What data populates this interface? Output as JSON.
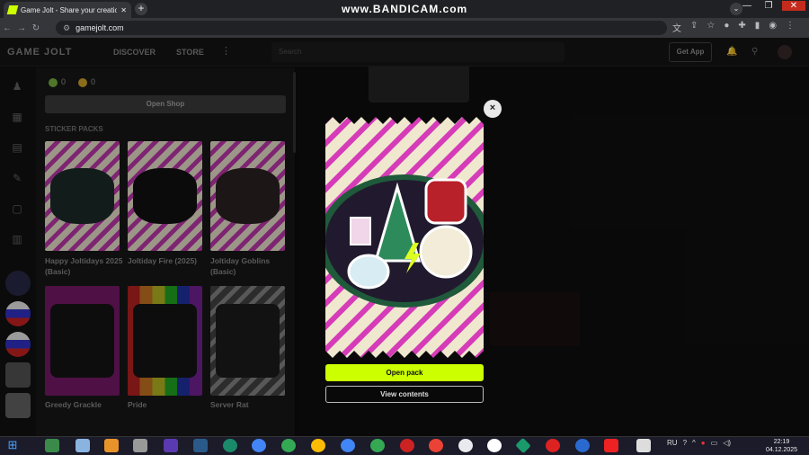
{
  "browser": {
    "tab_title": "Game Jolt - Share your creations",
    "new_tab": "+",
    "url": "gamejolt.com",
    "recorder_watermark": "www.BANDICAM.com",
    "win_min": "—",
    "win_max": "❐",
    "win_close": "✕"
  },
  "header": {
    "logo": "GAME JOLT",
    "discover": "DISCOVER",
    "store": "STORE",
    "more": "⋮",
    "search_placeholder": "Search",
    "get_app": "Get App"
  },
  "shop": {
    "joltbux": "0",
    "coins": "0",
    "open_shop": "Open Shop",
    "section_label": "STICKER PACKS",
    "packs": [
      {
        "name": "Happy Joltidays 2025 (Basic)"
      },
      {
        "name": "Joltiday Fire (2025)"
      },
      {
        "name": "Joltiday Goblins (Basic)"
      },
      {
        "name": "Greedy Grackle"
      },
      {
        "name": "Pride"
      },
      {
        "name": "Server Rat"
      }
    ]
  },
  "modal": {
    "close": "×",
    "open_pack": "Open pack",
    "view_contents": "View contents"
  },
  "taskbar": {
    "lang": "RU",
    "time": "22:19",
    "date": "04.12.2025"
  },
  "colors": {
    "accent": "#ccff00",
    "stripe_pink": "#e040c0",
    "pack_bg": "#f0ead0"
  }
}
